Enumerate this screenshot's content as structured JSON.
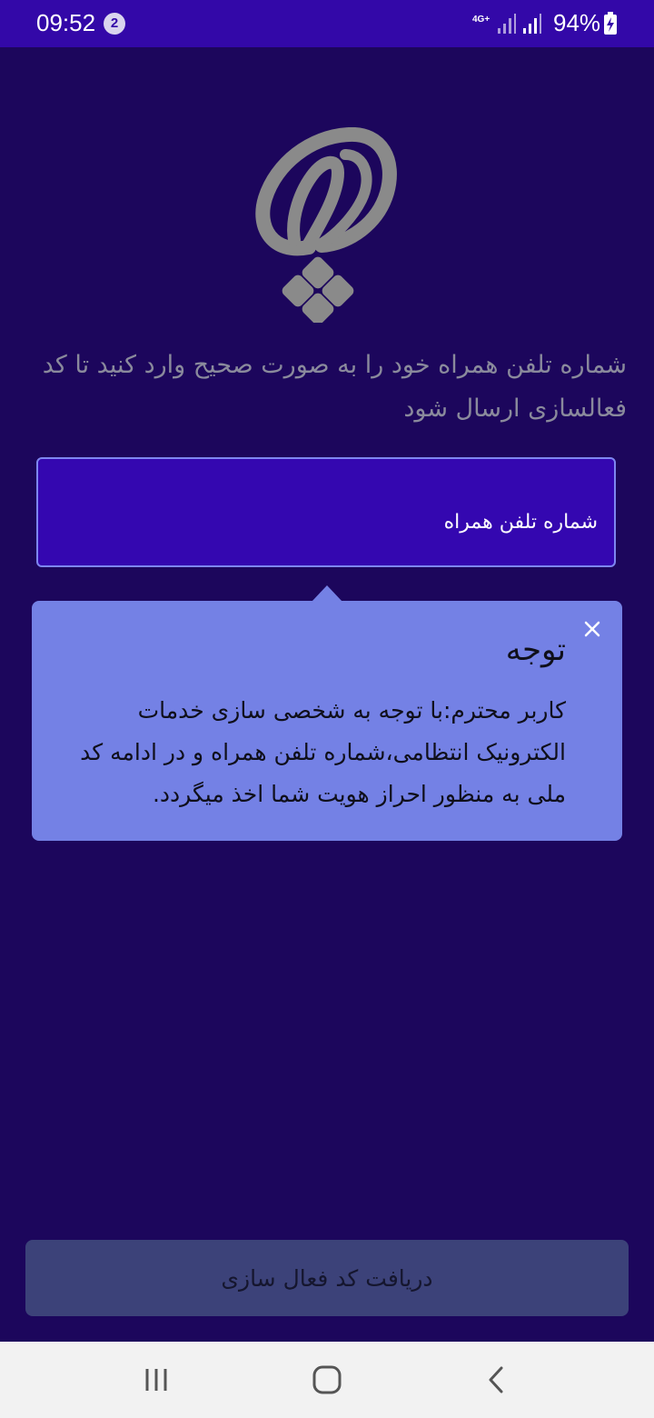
{
  "status_bar": {
    "time": "09:52",
    "notification_count": "2",
    "network_type": "4G+",
    "battery_percent": "94%",
    "background_color": "#3308a8"
  },
  "logo": {
    "icon": "brand-logo-icon"
  },
  "instruction": {
    "text": "شماره تلفن همراه خود را به صورت صحیح وارد کنید تا کد فعالسازی ارسال شود"
  },
  "phone_field": {
    "placeholder": "شماره تلفن همراه",
    "value": ""
  },
  "tooltip": {
    "title": "توجه",
    "body": "کاربر محترم:با توجه به شخصی سازی خدمات الکترونیک انتظامی،شماره تلفن همراه و در ادامه کد ملی به منظور احراز هویت شما اخذ میگردد.",
    "close_icon": "close-icon",
    "background_color": "#7481e5"
  },
  "submit_button": {
    "label": "دریافت کد فعال سازی",
    "background_color": "#3c4279"
  },
  "nav_bar": {
    "recent_icon": "recent-apps-icon",
    "home_icon": "home-icon",
    "back_icon": "back-icon"
  },
  "colors": {
    "page_background": "#1c065c",
    "field_background": "#3407b0",
    "field_border": "#7e86f0"
  }
}
